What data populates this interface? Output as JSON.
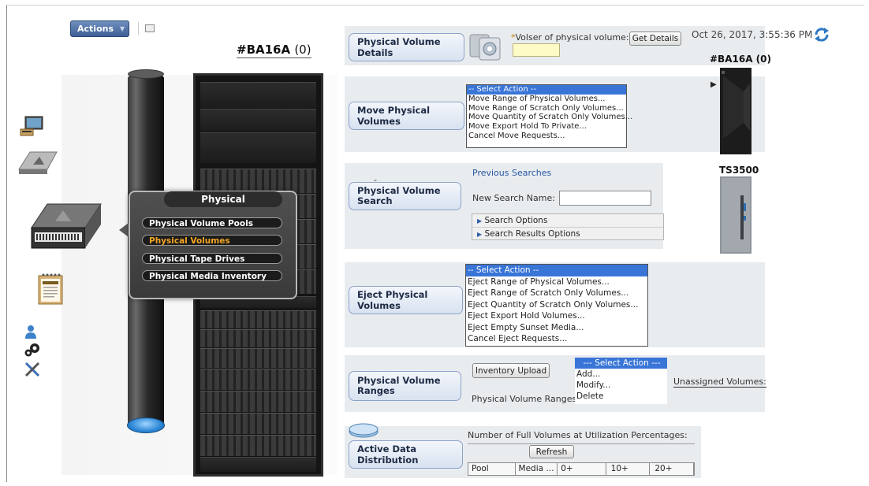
{
  "toolbar": {
    "actions_label": "Actions",
    "actions_caret": "▼"
  },
  "system": {
    "name": "#BA16A",
    "count": "(0)"
  },
  "popup": {
    "title": "Physical",
    "items": [
      {
        "label": "Physical Volume Pools",
        "active": false
      },
      {
        "label": "Physical Volumes",
        "active": true
      },
      {
        "label": "Physical Tape Drives",
        "active": false
      },
      {
        "label": "Physical Media Inventory",
        "active": false
      }
    ]
  },
  "details": {
    "pill": "Physical Volume Details",
    "volser_label": "Volser of physical volume:",
    "required_mark": "*",
    "volser_value": "",
    "get_details": "Get Details"
  },
  "timestamp": "Oct 26, 2017, 3:55:36 PM",
  "move": {
    "pill": "Move Physical Volumes",
    "options": [
      "-- Select Action --",
      "Move Range of Physical Volumes...",
      "Move Range of Scratch Only Volumes...",
      "Move Quantity of Scratch Only Volumes...",
      "Move Export Hold To Private...",
      "Cancel Move Requests..."
    ]
  },
  "search": {
    "pill": "Physical Volume Search",
    "previous": "Previous Searches",
    "new_name_label": "New Search Name:",
    "new_name_value": "",
    "options": "Search Options",
    "results_options": "Search Results Options",
    "marker": "-"
  },
  "eject": {
    "pill": "Eject Physical Volumes",
    "options": [
      "-- Select Action --",
      "Eject Range of Physical Volumes...",
      "Eject Range of Scratch Only Volumes...",
      "Eject Quantity of Scratch Only Volumes...",
      "Eject Export Hold Volumes...",
      "Eject Empty Sunset Media...",
      "Cancel Eject Requests..."
    ]
  },
  "ranges": {
    "pill": "Physical Volume Ranges",
    "inventory_upload": "Inventory Upload",
    "ranges_label": "Physical Volume Ranges:",
    "unassigned_label": "Unassigned Volumes:",
    "options": [
      "--- Select Action ---",
      "Add...",
      "Modify...",
      "Delete"
    ]
  },
  "distribution": {
    "pill": "Active Data Distribution",
    "caption": "Number of Full Volumes at Utilization Percentages:",
    "refresh": "Refresh",
    "columns": [
      "Pool",
      "Media ...",
      "0+",
      "10+",
      "20+"
    ]
  },
  "right_panel": {
    "system_label": "#BA16A (0)",
    "library_label": "TS3500",
    "pointer": "▶"
  },
  "colors": {
    "accent": "#3875d7",
    "pill_border": "#8ca3c8",
    "active_menu": "#f5a623"
  }
}
